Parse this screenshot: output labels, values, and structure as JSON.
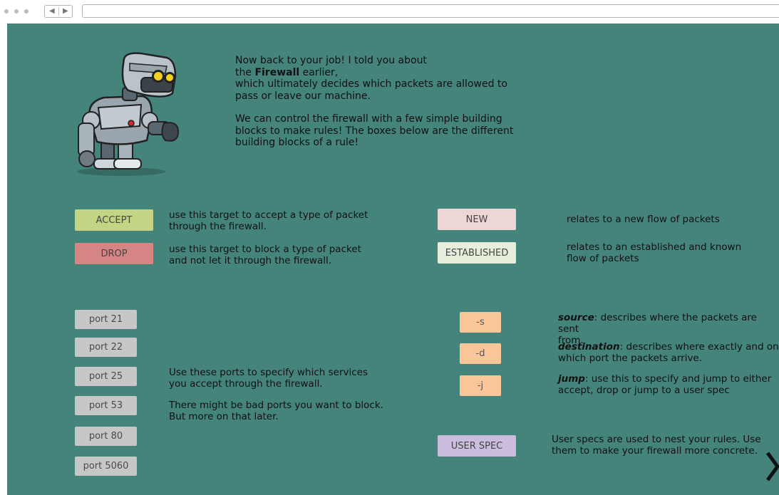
{
  "intro": {
    "line1": "Now back to your job! I told you about",
    "line2_pre": "the ",
    "line2_bold": "Firewall",
    "line2_post": " earlier,",
    "line3": "which ultimately decides which packets are allowed to",
    "line4": "pass or leave our machine.",
    "line5": "We can control the firewall with a few simple building",
    "line6": "blocks to make rules! The boxes below are the different",
    "line7": "building blocks of a rule!"
  },
  "targets": {
    "accept_label": "ACCEPT",
    "accept_desc_1": "use this target to accept a type of packet",
    "accept_desc_2": "through the firewall.",
    "drop_label": "DROP",
    "drop_desc_1": "use this target to block a type of packet",
    "drop_desc_2": "and not let it through the firewall."
  },
  "states": {
    "new_label": "NEW",
    "new_desc": "relates to a new flow of packets",
    "established_label": "ESTABLISHED",
    "established_desc_1": "relates to an established and known",
    "established_desc_2": "flow of packets"
  },
  "ports": {
    "items": [
      "port 21",
      "port 22",
      "port 25",
      "port 53",
      "port 80",
      "port 5060"
    ],
    "desc_1": "Use these ports to specify which services",
    "desc_2": "you accept through the firewall.",
    "desc_3": "There might be bad ports you want to block.",
    "desc_4": "But more on that later."
  },
  "flags": {
    "source_label": "-s",
    "source_term": "source",
    "source_desc_1": ": describes where the packets are sent",
    "source_desc_2": "from.",
    "dest_label": "-d",
    "dest_term": "destination",
    "dest_desc_1": ": describes where exactly and on",
    "dest_desc_2": "which port the packets arrive.",
    "jump_label": "-j",
    "jump_term": "jump",
    "jump_desc_1": ": use this to specify and jump to either",
    "jump_desc_2": "accept, drop or jump to a user spec"
  },
  "user_spec": {
    "label": "USER SPEC",
    "desc_1": "User specs are used to nest your rules. Use",
    "desc_2": "them to make your firewall more concrete."
  },
  "icons": {
    "robot": "robot-mascot",
    "next": "chevron-right-icon",
    "back": "triangle-left-icon",
    "forward": "triangle-right-icon"
  },
  "colors": {
    "background": "#44847a",
    "accept": "#c3d585",
    "drop": "#d68585",
    "new": "#efd6d6",
    "established": "#e7eedb",
    "port": "#c7c7c7",
    "flag": "#fac598",
    "user_spec": "#cbbddd"
  }
}
